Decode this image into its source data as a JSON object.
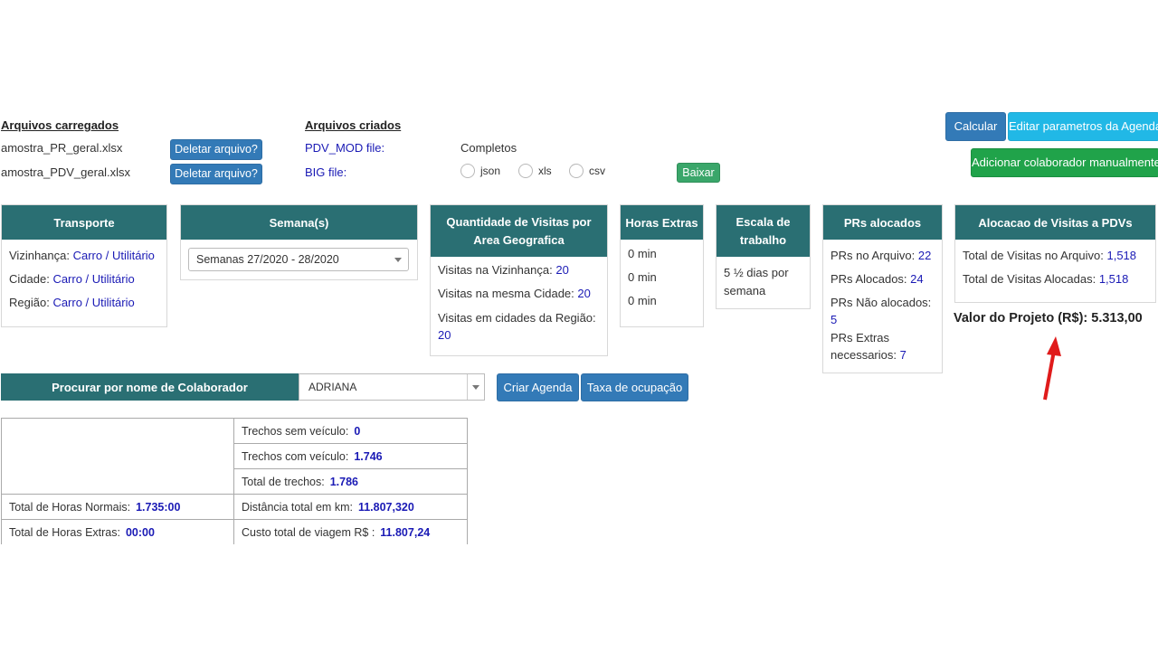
{
  "uploaded": {
    "title": "Arquivos carregados",
    "files": [
      "amostra_PR_geral.xlsx",
      "amostra_PDV_geral.xlsx"
    ],
    "delete_label": "Deletar arquivo?"
  },
  "created": {
    "title": "Arquivos criados",
    "pdv_label": "PDV_MOD file:",
    "big_label": "BIG file:",
    "status": "Completos",
    "formats": [
      "json",
      "xls",
      "csv"
    ],
    "download_label": "Baixar"
  },
  "actions": {
    "calcular": "Calcular",
    "editar": "Editar parametros da Agenda",
    "adicionar": "Adicionar colaborador manualmente"
  },
  "transporte": {
    "title": "Transporte",
    "rows": [
      {
        "label": "Vizinhança:",
        "value": "Carro / Utilitário"
      },
      {
        "label": "Cidade:",
        "value": "Carro / Utilitário"
      },
      {
        "label": "Região:",
        "value": "Carro / Utilitário"
      }
    ]
  },
  "semana": {
    "title": "Semana(s)",
    "selected": "Semanas 27/2020 - 28/2020"
  },
  "visitas_area": {
    "title": "Quantidade de Visitas por Area Geografica",
    "vizinhanca_label": "Visitas na Vizinhança:",
    "vizinhanca_value": "20",
    "cidade_label": "Visitas na mesma Cidade:",
    "cidade_value": "20",
    "regiao_label": "Visitas em cidades da Região:",
    "regiao_value": "20"
  },
  "horas_extras": {
    "title": "Horas Extras",
    "values": [
      "0 min",
      "0 min",
      "0 min"
    ]
  },
  "escala": {
    "title": "Escala de trabalho",
    "value": "5 ½ dias por semana"
  },
  "prs": {
    "title": "PRs alocados",
    "arquivo_label": "PRs no Arquivo:",
    "arquivo_value": "22",
    "alocados_label": "PRs Alocados:",
    "alocados_value": "24",
    "nao_label": "PRs Não alocados:",
    "nao_value": "5",
    "extras_label": "PRs Extras necessarios:",
    "extras_value": "7"
  },
  "alocacao": {
    "title": "Alocacao de Visitas a PDVs",
    "total_arquivo_label": "Total de Visitas no Arquivo:",
    "total_arquivo_value": "1,518",
    "total_alocadas_label": "Total de Visitas Alocadas:",
    "total_alocadas_value": "1,518",
    "valor_projeto": "Valor do Projeto (R$): 5.313,00"
  },
  "search": {
    "label": "Procurar por nome de Colaborador",
    "value": "ADRIANA",
    "criar": "Criar Agenda",
    "taxa": "Taxa de ocupação"
  },
  "stats": {
    "trechos_sem_label": "Trechos sem veículo:",
    "trechos_sem_value": "0",
    "trechos_com_label": "Trechos com veículo:",
    "trechos_com_value": "1.746",
    "total_trechos_label": "Total de trechos:",
    "total_trechos_value": "1.786",
    "horas_normais_label": "Total de Horas Normais:",
    "horas_normais_value": "1.735:00",
    "distancia_label": "Distância total em km:",
    "distancia_value": "11.807,320",
    "horas_extras_label": "Total de Horas Extras:",
    "horas_extras_value": "00:00",
    "custo_label": "Custo total de viagem R$ :",
    "custo_value": "11.807,24"
  },
  "colors": {
    "panel_header": "#2a6f73",
    "button_blue": "#337ab7",
    "link_blue": "#1a1ab5",
    "arrow_red": "#e01b1b"
  }
}
